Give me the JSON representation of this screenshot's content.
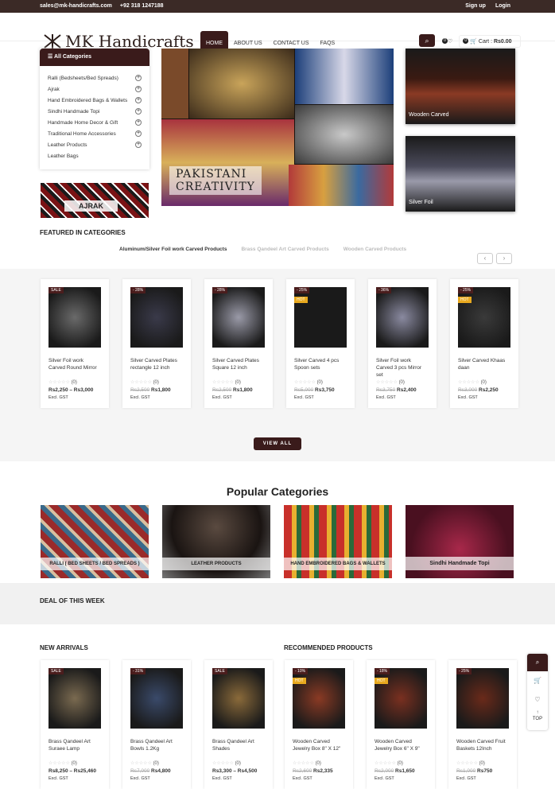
{
  "topbar": {
    "email": "sales@mk-handicrafts.com",
    "phone": "+92 318 1247188",
    "signup": "Sign up",
    "login": "Login"
  },
  "logo": "MK Handicrafts",
  "menu": [
    "HOME",
    "ABOUT US",
    "CONTACT US",
    "FAQS"
  ],
  "cart": {
    "label": "Cart :",
    "amount": "Rs0.00",
    "wish_count": "0",
    "cart_count": "0"
  },
  "sidebar": {
    "title": "All Categories",
    "items": [
      "Ralli (Bedsheets/Bed Spreads)",
      "Ajrak",
      "Hand Embroidered Bags & Wallets",
      "Sindhi Handmade Topi",
      "Handmade Home Decor & Gift",
      "Traditional Home Accessories",
      "Leather Products",
      "Leather Bags"
    ]
  },
  "ajrak_label": "AJRAK",
  "hero_caption": [
    "PAKISTANI",
    "CREATIVITY"
  ],
  "promos": [
    "Wooden Carved",
    "Silver Foil"
  ],
  "featured": {
    "title": "FEATURED IN CATEGORIES",
    "tabs": [
      "Aluminum/Silver Foil work Carved Products",
      "Brass Qandeel Art Carved Products",
      "Wooden Carved Products"
    ]
  },
  "products": [
    {
      "name": "Silver Foil work Carved Round Mirror",
      "tag": "SALE",
      "hot": "",
      "old": "",
      "price": "Rs2,250 – Rs3,000",
      "reviews": "(0)",
      "gst": "Excl. GST"
    },
    {
      "name": "Silver Carved Plates rectangle 12 inch",
      "tag": "- 28%",
      "hot": "",
      "old": "Rs2,500",
      "price": "Rs1,800",
      "reviews": "(0)",
      "gst": "Excl. GST"
    },
    {
      "name": "Silver Carved Plates Square 12 inch",
      "tag": "- 28%",
      "hot": "",
      "old": "Rs2,500",
      "price": "Rs1,800",
      "reviews": "(0)",
      "gst": "Excl. GST"
    },
    {
      "name": "Silver Carved 4 pcs Spoon sets",
      "tag": "- 25%",
      "hot": "HOT",
      "old": "Rs5,000",
      "price": "Rs3,750",
      "reviews": "(0)",
      "gst": "Excl. GST"
    },
    {
      "name": "Silver Foil work Carved 3 pcs Mirror set",
      "tag": "- 36%",
      "hot": "",
      "old": "Rs3,750",
      "price": "Rs2,400",
      "reviews": "(0)",
      "gst": "Excl. GST"
    },
    {
      "name": "Silver Carved Khaas daan",
      "tag": "- 25%",
      "hot": "HOT",
      "old": "Rs3,000",
      "price": "Rs2,250",
      "reviews": "(0)",
      "gst": "Excl. GST"
    }
  ],
  "view_all": "VIEW ALL",
  "popular": {
    "title": "Popular Categories",
    "items": [
      "RALLI ( BED SHEETS / BED SPREADS )",
      "LEATHER PRODUCTS",
      "HAND EMBROIDERED BAGS & WALLETS",
      "Sindhi Handmade Topi"
    ]
  },
  "deal_title": "DEAL OF THIS WEEK",
  "new_arrivals": {
    "title": "NEW ARRIVALS",
    "items": [
      {
        "name": "Brass Qandeel Art Suraee Lamp",
        "tag": "SALE",
        "hot": "",
        "old": "",
        "price": "Rs8,250 – Rs25,460",
        "reviews": "(0)",
        "gst": "Excl. GST"
      },
      {
        "name": "Brass Qandeel Art Bowls 1.2Kg",
        "tag": "- 31%",
        "hot": "",
        "old": "Rs7,000",
        "price": "Rs4,800",
        "reviews": "(0)",
        "gst": "Excl. GST"
      },
      {
        "name": "Brass Qandeel Art Shades",
        "tag": "SALE",
        "hot": "",
        "old": "",
        "price": "Rs3,300 – Rs4,500",
        "reviews": "(0)",
        "gst": "Excl. GST"
      }
    ]
  },
  "recommended": {
    "title": "RECOMMENDED PRODUCTS",
    "items": [
      {
        "name": "Wooden Carved Jewelry Box 8\" X 12\"",
        "tag": "- 10%",
        "hot": "HOT",
        "old": "Rs2,600",
        "price": "Rs2,335",
        "reviews": "(0)",
        "gst": "Excl. GST"
      },
      {
        "name": "Wooden Carved Jewelry Box 6\" X 9\"",
        "tag": "- 18%",
        "hot": "HOT",
        "old": "Rs2,000",
        "price": "Rs1,650",
        "reviews": "(0)",
        "gst": "Excl. GST"
      },
      {
        "name": "Wooden Carved Fruit Baskets 12Inch",
        "tag": "- 25%",
        "hot": "",
        "old": "Rs1,000",
        "price": "Rs750",
        "reviews": "(0)",
        "gst": "Excl. GST"
      }
    ]
  },
  "float_top": "TOP"
}
